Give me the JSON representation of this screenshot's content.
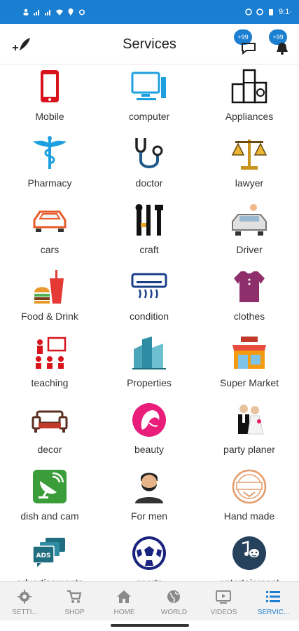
{
  "status_bar": {
    "time": "9:1·"
  },
  "app_bar": {
    "title": "Services",
    "badge_1": "+99",
    "badge_2": "+99"
  },
  "services": [
    {
      "label": "Mobile"
    },
    {
      "label": "computer"
    },
    {
      "label": "Appliances"
    },
    {
      "label": "Pharmacy"
    },
    {
      "label": "doctor"
    },
    {
      "label": "lawyer"
    },
    {
      "label": "cars"
    },
    {
      "label": "craft"
    },
    {
      "label": "Driver"
    },
    {
      "label": "Food & Drink"
    },
    {
      "label": "condition"
    },
    {
      "label": "clothes"
    },
    {
      "label": "teaching"
    },
    {
      "label": "Properties"
    },
    {
      "label": "Super Market"
    },
    {
      "label": "decor"
    },
    {
      "label": "beauty"
    },
    {
      "label": "party planer"
    },
    {
      "label": "dish and cam"
    },
    {
      "label": "For men"
    },
    {
      "label": "Hand made"
    },
    {
      "label": "advertisements"
    },
    {
      "label": "sports"
    },
    {
      "label": "entertainment"
    }
  ],
  "bottom_nav": [
    {
      "label": "SETTI..."
    },
    {
      "label": "SHOP"
    },
    {
      "label": "HOME"
    },
    {
      "label": "WORLD"
    },
    {
      "label": "VIDEOS"
    },
    {
      "label": "SERVIC..."
    }
  ],
  "colors": {
    "accent": "#1b7fd1",
    "nav_inactive": "#8a8a8a"
  }
}
